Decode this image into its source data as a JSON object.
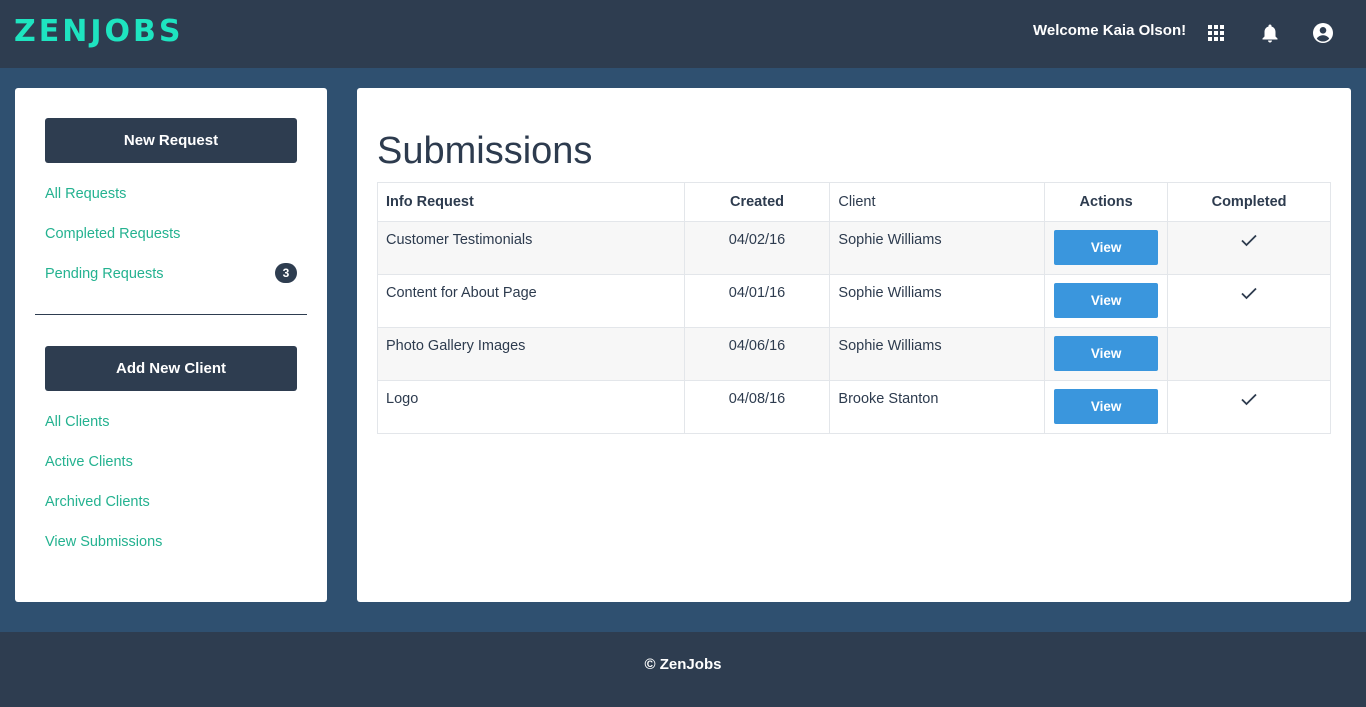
{
  "header": {
    "logo": "ZENJOBS",
    "welcome": "Welcome Kaia Olson!",
    "icons": [
      "apps-grid-icon",
      "bell-icon",
      "account-circle-icon"
    ],
    "brand_color": "#1ee4c0"
  },
  "sidebar": {
    "new_request_label": "New Request",
    "request_links": [
      {
        "label": "All Requests"
      },
      {
        "label": "Completed Requests"
      },
      {
        "label": "Pending Requests",
        "badge": "3"
      }
    ],
    "add_client_label": "Add New Client",
    "client_links": [
      {
        "label": "All Clients"
      },
      {
        "label": "Active Clients"
      },
      {
        "label": "Archived Clients"
      },
      {
        "label": "View Submissions"
      }
    ]
  },
  "main": {
    "title": "Submissions",
    "columns": [
      "Info Request",
      "Created",
      "Client",
      "Actions",
      "Completed"
    ],
    "rows": [
      {
        "info_request": "Customer Testimonials",
        "created": "04/02/16",
        "client": "Sophie Williams",
        "action": "View",
        "completed": true
      },
      {
        "info_request": "Content for About Page",
        "created": "04/01/16",
        "client": "Sophie Williams",
        "action": "View",
        "completed": true
      },
      {
        "info_request": "Photo Gallery Images",
        "created": "04/06/16",
        "client": "Sophie Williams",
        "action": "View",
        "completed": false
      },
      {
        "info_request": "Logo",
        "created": "04/08/16",
        "client": "Brooke Stanton",
        "action": "View",
        "completed": true
      }
    ]
  },
  "footer": {
    "text": "© ZenJobs"
  },
  "colors": {
    "navy": "#2e3d50",
    "background": "#2f5070",
    "link_green": "#24b290",
    "button_blue": "#3a96dd"
  }
}
